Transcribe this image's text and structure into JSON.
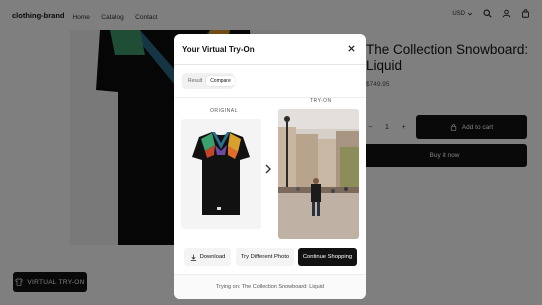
{
  "header": {
    "brand": "clothing-brand",
    "nav": [
      "Home",
      "Catalog",
      "Contact"
    ],
    "currency": "USD"
  },
  "product": {
    "title": "The Collection Snowboard: Liquid",
    "price": "$749.95",
    "quantity": "1",
    "add_to_cart": "Add to cart",
    "buy_now": "Buy it now"
  },
  "virtual_tryon_button": "VIRTUAL TRY-ON",
  "modal": {
    "title": "Your Virtual Try-On",
    "tabs": [
      "Result",
      "Compare"
    ],
    "active_tab": "Compare",
    "original_label": "ORIGINAL",
    "tryon_label": "TRY-ON",
    "download": "Download",
    "try_different": "Try Different Photo",
    "continue": "Continue Shopping",
    "footer": "Trying on: The Collection Snowboard: Liquid"
  },
  "colors": {
    "primary": "#121212",
    "overlay": "rgba(0,0,0,0.5)"
  },
  "icons": {
    "search": "search-icon",
    "account": "account-icon",
    "cart": "cart-icon",
    "close": "close-icon",
    "chevron_down": "chevron-down-icon",
    "chevron_right": "chevron-right-icon",
    "download": "download-icon",
    "bag": "bag-icon",
    "shirt": "shirt-icon"
  }
}
